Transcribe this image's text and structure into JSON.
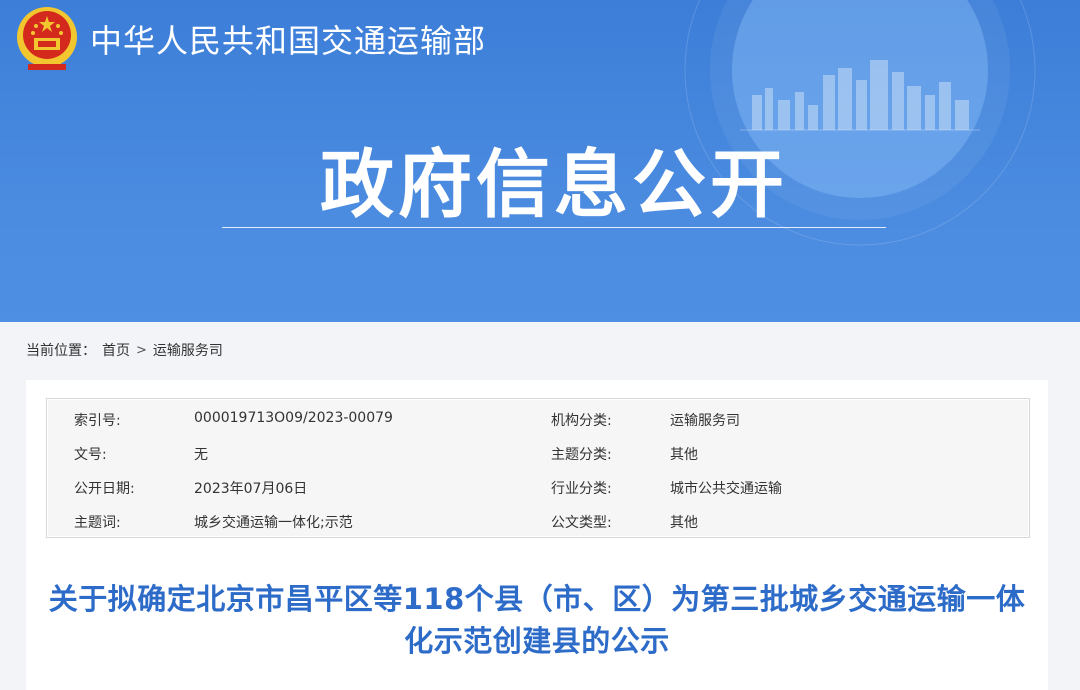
{
  "header": {
    "site_name": "中华人民共和国交通运输部",
    "banner_title": "政府信息公开"
  },
  "colors": {
    "banner_blue": "#3c7ed8",
    "title_blue": "#2d6bc8",
    "emblem_red": "#d42a1e",
    "emblem_gold": "#f2c62f"
  },
  "icons": {
    "emblem": "national-emblem-icon"
  },
  "breadcrumb": {
    "prefix": "当前位置：",
    "home": "首页",
    "separator": ">",
    "current": "运输服务司"
  },
  "meta": {
    "rows": [
      {
        "label1": "索引号:",
        "value1": "000019713O09/2023-00079",
        "label2": "机构分类:",
        "value2": "运输服务司"
      },
      {
        "label1": "文号:",
        "value1": "无",
        "label2": "主题分类:",
        "value2": "其他"
      },
      {
        "label1": "公开日期:",
        "value1": "2023年07月06日",
        "label2": "行业分类:",
        "value2": "城市公共交通运输"
      },
      {
        "label1": "主题词:",
        "value1": "城乡交通运输一体化;示范",
        "label2": "公文类型:",
        "value2": "其他"
      }
    ]
  },
  "document": {
    "title_line1": "关于拟确定北京市昌平区等118个县（市、区）为第三批城乡交通运输一体",
    "title_line2": "化示范创建县的公示"
  }
}
